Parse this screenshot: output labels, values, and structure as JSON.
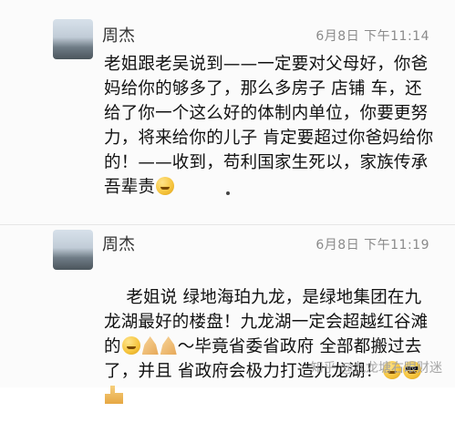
{
  "messages": [
    {
      "name": "周杰",
      "time": "6月8日  下午11:14",
      "text": "老姐跟老吴说到——一定要对父母好，你爸妈给你的够多了，那么多房子 店铺 车，还给了你一个这么好的体制内单位，你要更努力，将来给你的儿子 肯定要超过你爸妈给你的！——收到，苟利国家生死以，家族传承吾辈责",
      "trailing_emoji": "determined-face-emoji"
    },
    {
      "name": "周杰",
      "time": "6月8日  下午11:19",
      "text_part1": "老姐说 绿地海珀九龙，是绿地集团在九龙湖最好的楼盘！九龙湖一定会超越红谷滩的",
      "inline_emojis": [
        "grin-emoji",
        "pray-hands-emoji",
        "pray-hands-emoji"
      ],
      "text_part2": "～毕竟省委省政府 全部都搬过去了，并且 省政府会极力打造九龙湖！",
      "trailing_emojis": [
        "smile-emoji",
        "sunglasses-emoji",
        "thumbs-up-emoji"
      ]
    }
  ],
  "watermark": "知乎 @九龙塘右眼财迷"
}
